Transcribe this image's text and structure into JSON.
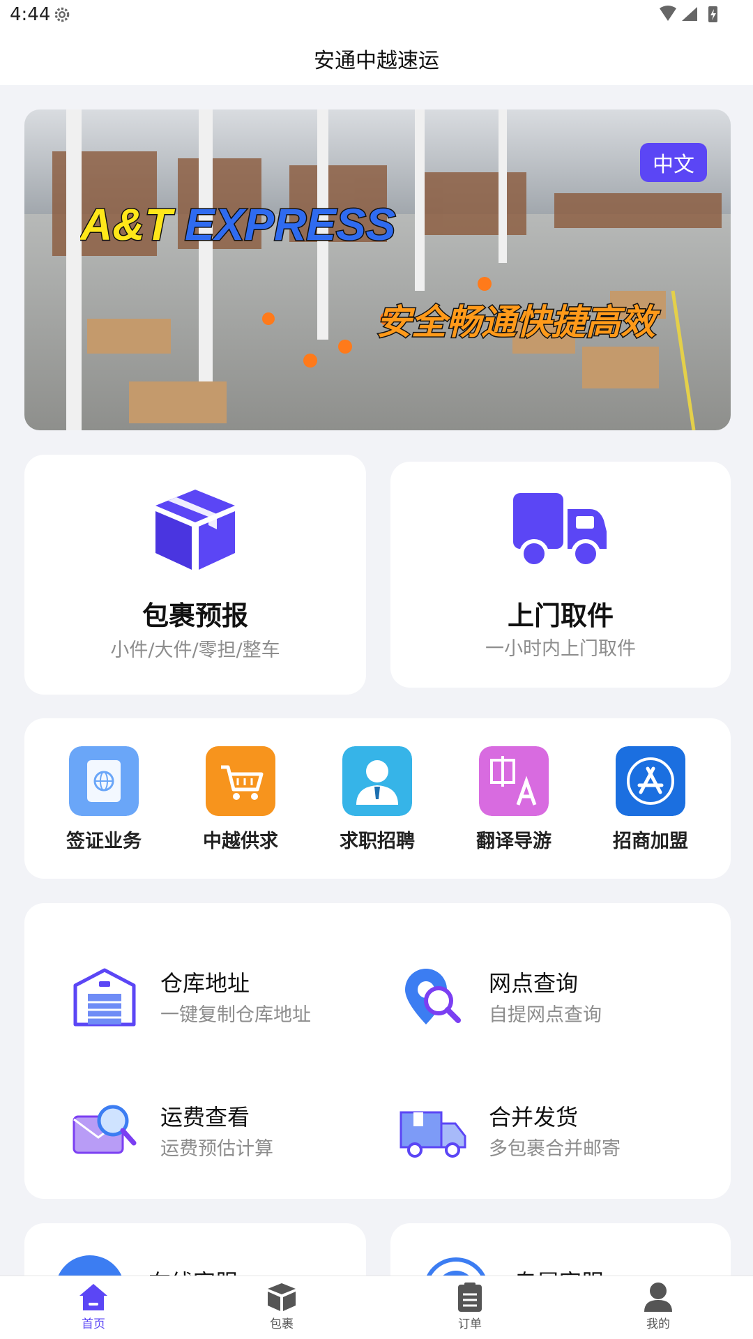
{
  "status_bar": {
    "time": "4:44"
  },
  "app": {
    "title": "安通中越速运"
  },
  "banner": {
    "brand_text_1": "A&T",
    "brand_text_2": "EXPRESS",
    "slogan": "安全畅通快捷高效",
    "language_badge": "中文"
  },
  "main_cards": [
    {
      "title": "包裹预报",
      "subtitle": "小件/大件/零担/整车",
      "icon": "package-icon"
    },
    {
      "title": "上门取件",
      "subtitle": "一小时内上门取件",
      "icon": "truck-icon"
    }
  ],
  "quick_links": [
    {
      "label": "签证业务",
      "icon": "passport-icon",
      "color": "#6aa6f8"
    },
    {
      "label": "中越供求",
      "icon": "cart-icon",
      "color": "#f7941d"
    },
    {
      "label": "求职招聘",
      "icon": "recruiter-icon",
      "color": "#36b4e8"
    },
    {
      "label": "翻译导游",
      "icon": "translate-icon",
      "color": "#d86be0"
    },
    {
      "label": "招商加盟",
      "icon": "app-store-icon",
      "color": "#1b6fe0"
    }
  ],
  "services": [
    {
      "title": "仓库地址",
      "subtitle": "一键复制仓库地址",
      "icon": "warehouse-icon"
    },
    {
      "title": "网点查询",
      "subtitle": "自提网点查询",
      "icon": "location-search-icon"
    },
    {
      "title": "运费查看",
      "subtitle": "运费预估计算",
      "icon": "mail-search-icon"
    },
    {
      "title": "合并发货",
      "subtitle": "多包裹合并邮寄",
      "icon": "delivery-truck-icon"
    }
  ],
  "support_cards": [
    {
      "title": "在线客服"
    },
    {
      "title": "专属客服"
    }
  ],
  "tab_bar": {
    "active": "首页",
    "tabs": [
      {
        "label": "首页",
        "icon": "home-icon"
      },
      {
        "label": "包裹",
        "icon": "box-icon"
      },
      {
        "label": "订单",
        "icon": "clipboard-icon"
      },
      {
        "label": "我的",
        "icon": "user-icon"
      }
    ]
  },
  "colors": {
    "accent": "#5b46f5",
    "background": "#f2f3f7",
    "muted_text": "#8d8d8d"
  }
}
